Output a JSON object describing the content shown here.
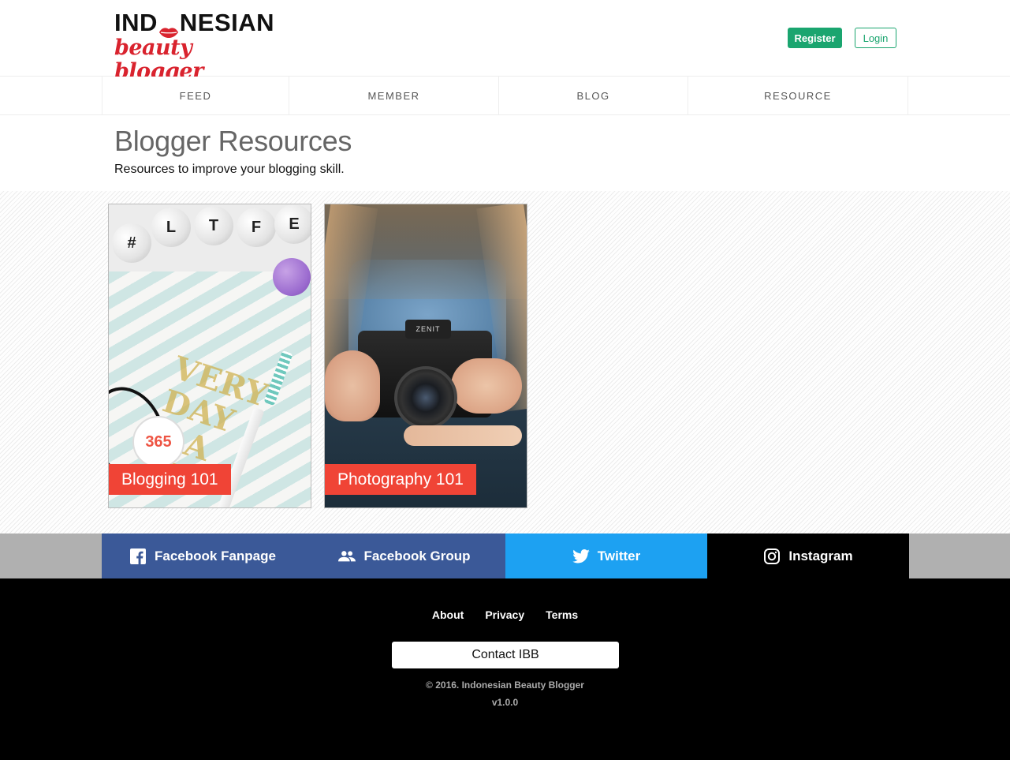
{
  "header": {
    "logo": {
      "line1_left": "IND",
      "line1_right": "NESIAN",
      "line2": "beauty blogger"
    },
    "register_label": "Register",
    "login_label": "Login"
  },
  "nav": {
    "items": [
      {
        "label": "FEED"
      },
      {
        "label": "MEMBER"
      },
      {
        "label": "BLOG"
      },
      {
        "label": "RESOURCE"
      }
    ]
  },
  "main": {
    "title": "Blogger Resources",
    "subtitle": "Resources to improve your blogging skill.",
    "cards": [
      {
        "label": "Blogging 101"
      },
      {
        "label": "Photography 101"
      }
    ]
  },
  "social": {
    "items": [
      {
        "label": "Facebook Fanpage",
        "icon": "facebook-icon"
      },
      {
        "label": "Facebook Group",
        "icon": "group-icon"
      },
      {
        "label": "Twitter",
        "icon": "twitter-icon"
      },
      {
        "label": "Instagram",
        "icon": "instagram-icon"
      }
    ]
  },
  "footer": {
    "links": [
      {
        "label": "About"
      },
      {
        "label": "Privacy"
      },
      {
        "label": "Terms"
      }
    ],
    "contact_label": "Contact IBB",
    "copyright": "© 2016. Indonesian Beauty Blogger",
    "version": "v1.0.0"
  },
  "colors": {
    "brand_red": "#d9232e",
    "register_green": "#1aa56f",
    "card_label_red": "#f04436",
    "facebook_blue": "#3b5998",
    "twitter_blue": "#1da1f2"
  }
}
